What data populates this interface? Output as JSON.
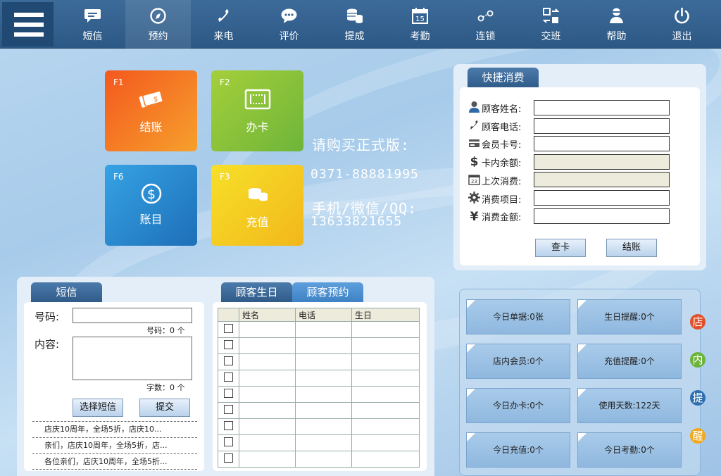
{
  "nav": {
    "menu_label": "",
    "items": [
      {
        "label": "短信",
        "icon": "chat-icon"
      },
      {
        "label": "预约",
        "icon": "compass-icon"
      },
      {
        "label": "来电",
        "icon": "phone-icon"
      },
      {
        "label": "评价",
        "icon": "comment-icon"
      },
      {
        "label": "提成",
        "icon": "coins-icon"
      },
      {
        "label": "考勤",
        "icon": "calendar-icon"
      },
      {
        "label": "连锁",
        "icon": "chain-icon"
      },
      {
        "label": "交班",
        "icon": "shift-icon"
      },
      {
        "label": "帮助",
        "icon": "help-icon"
      },
      {
        "label": "退出",
        "icon": "power-icon"
      }
    ]
  },
  "tiles": {
    "checkout": {
      "key": "F1",
      "label": "结账",
      "color": "#f07a1f"
    },
    "card": {
      "key": "F2",
      "label": "办卡",
      "color": "#8cc43c"
    },
    "accounts": {
      "key": "F6",
      "label": "账目",
      "color": "#2e8fd4"
    },
    "recharge": {
      "key": "F3",
      "label": "充值",
      "color": "#f4c61c"
    }
  },
  "promo": {
    "line1": "请购买正式版:",
    "phone": "0371-88881995",
    "line3": "手机/微信/QQ:",
    "mobile": "13633821655"
  },
  "quick": {
    "tab": "快捷消费",
    "fields": [
      {
        "label": "顾客姓名:",
        "value": ""
      },
      {
        "label": "顾客电话:",
        "value": ""
      },
      {
        "label": "会员卡号:",
        "value": ""
      },
      {
        "label": "卡内余额:",
        "value": ""
      },
      {
        "label": "上次消费:",
        "value": ""
      },
      {
        "label": "消费项目:",
        "value": ""
      },
      {
        "label": "消费金额:",
        "value": ""
      }
    ],
    "check_button": "查卡",
    "checkout_button": "结账"
  },
  "sms": {
    "tab": "短信",
    "number_label": "号码:",
    "number_value": "",
    "number_count": "号码：0 个",
    "content_label": "内容:",
    "content_value": "",
    "char_count": "字数：0 个",
    "choose_button": "选择短信",
    "submit_button": "提交",
    "templates": [
      "店庆10周年，全场5折，店庆10...",
      "亲们，店庆10周年，全场5折，店...",
      "各位亲们，店庆10周年，全场5折..."
    ]
  },
  "customers": {
    "tab_birthday": "顾客生日",
    "tab_booking": "顾客预约",
    "columns": [
      "姓名",
      "电话",
      "生日"
    ],
    "rows": 9
  },
  "reminders": {
    "cards": [
      "今日单据:0张",
      "生日提醒:0个",
      "店内会员:0个",
      "充值提醒:0个",
      "今日办卡:0个",
      "使用天数:122天",
      "今日充值:0个",
      "今日考勤:0个"
    ],
    "badges": [
      {
        "text": "店",
        "color": "#e0502a"
      },
      {
        "text": "内",
        "color": "#6cb33a"
      },
      {
        "text": "提",
        "color": "#2f6fb0"
      },
      {
        "text": "醒",
        "color": "#f0a81c"
      }
    ]
  }
}
